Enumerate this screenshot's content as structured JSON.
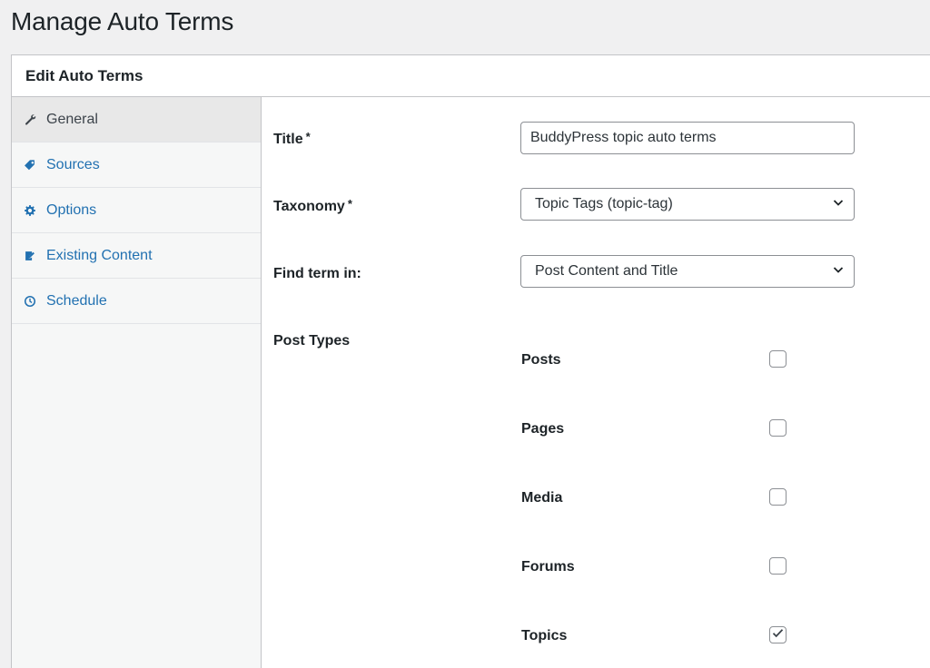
{
  "page": {
    "title": "Manage Auto Terms"
  },
  "panel": {
    "title": "Edit Auto Terms"
  },
  "sidebar": {
    "tabs": [
      {
        "label": "General",
        "icon": "wrench-icon",
        "active": true
      },
      {
        "label": "Sources",
        "icon": "tag-icon",
        "active": false
      },
      {
        "label": "Options",
        "icon": "gear-icon",
        "active": false
      },
      {
        "label": "Existing Content",
        "icon": "edit-page-icon",
        "active": false
      },
      {
        "label": "Schedule",
        "icon": "clock-icon",
        "active": false
      }
    ]
  },
  "form": {
    "title_label": "Title",
    "title_required": "*",
    "title_value": "BuddyPress topic auto terms",
    "taxonomy_label": "Taxonomy",
    "taxonomy_required": "*",
    "taxonomy_value": "Topic Tags (topic-tag)",
    "find_term_label": "Find term in:",
    "find_term_value": "Post Content and Title",
    "post_types_label": "Post Types",
    "post_types": [
      {
        "label": "Posts",
        "checked": false
      },
      {
        "label": "Pages",
        "checked": false
      },
      {
        "label": "Media",
        "checked": false
      },
      {
        "label": "Forums",
        "checked": false
      },
      {
        "label": "Topics",
        "checked": true
      }
    ]
  },
  "colors": {
    "link": "#2271b1",
    "border": "#c3c4c7",
    "background": "#f0f0f1"
  }
}
